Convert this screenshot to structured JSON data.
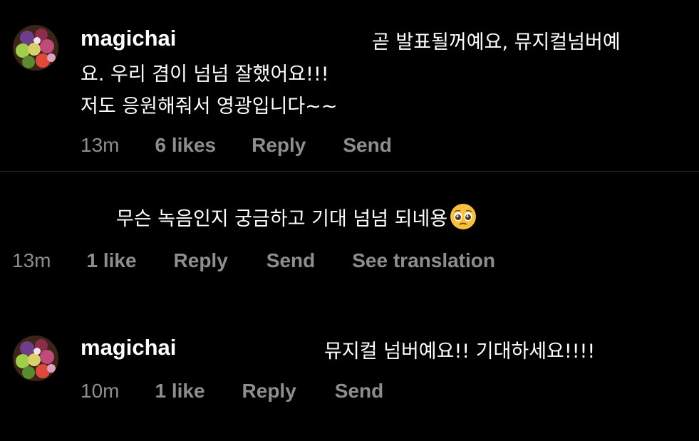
{
  "comments": [
    {
      "username": "magichai",
      "text_line1": "곧 발표될꺼예요, 뮤지컬넘버예",
      "text_line2": "요. 우리 겸이 넘넘 잘했어요!!!",
      "text_line3": "저도 응원해줘서 영광입니다~~",
      "time": "13m",
      "likes": "6 likes",
      "reply": "Reply",
      "send": "Send"
    },
    {
      "text": "무슨 녹음인지 궁금하고 기대 넘넘 되네용",
      "emoji": "pleading-face-emoji",
      "time": "13m",
      "likes": "1 like",
      "reply": "Reply",
      "send": "Send",
      "translate": "See translation"
    },
    {
      "username": "magichai",
      "text": "뮤지컬 넘버예요!! 기대하세요!!!!",
      "time": "10m",
      "likes": "1 like",
      "reply": "Reply",
      "send": "Send"
    }
  ],
  "colors": {
    "background": "#000000",
    "text": "#ffffff",
    "meta": "#8e8e8e",
    "divider": "#262626"
  }
}
